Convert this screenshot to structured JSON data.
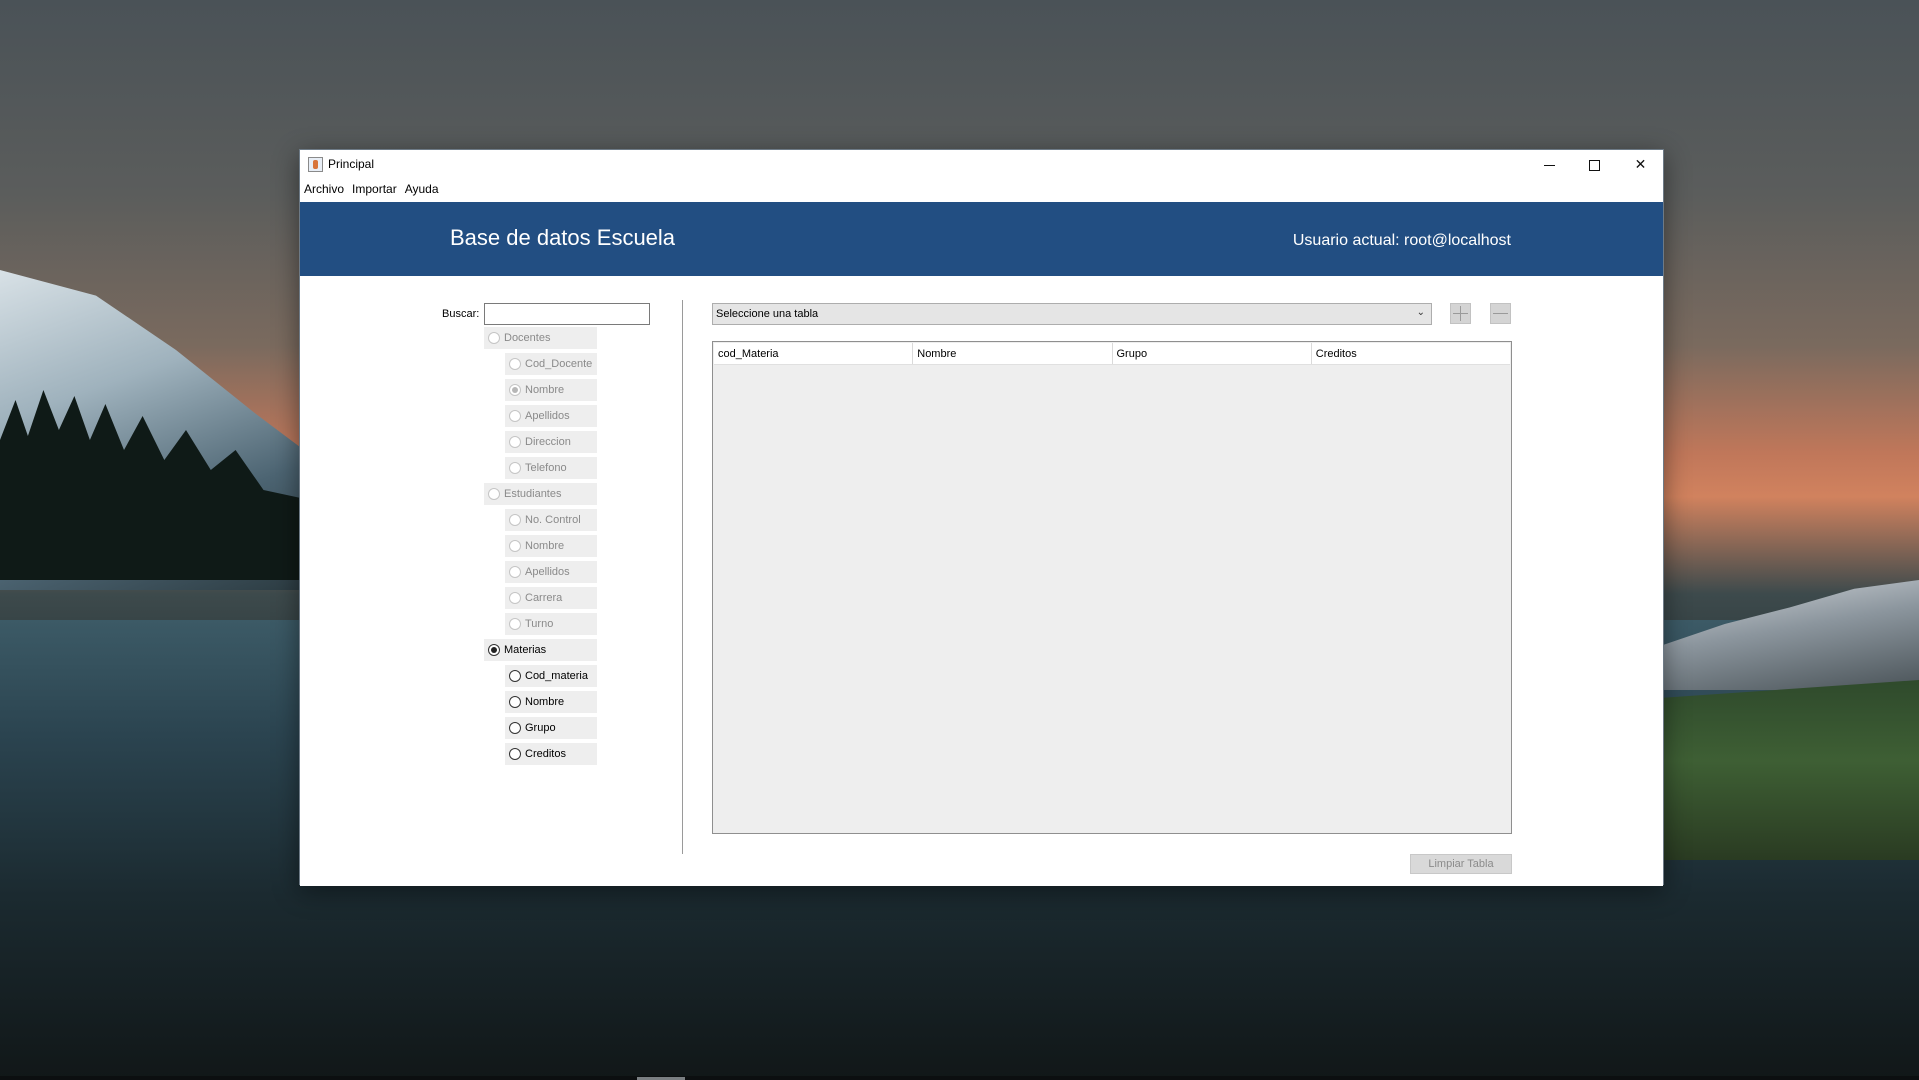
{
  "window": {
    "title": "Principal",
    "controls": {
      "minimize": "minimize",
      "maximize": "maximize",
      "close": "✕"
    }
  },
  "menubar": {
    "items": [
      "Archivo",
      "Importar",
      "Ayuda"
    ]
  },
  "header": {
    "title": "Base de datos Escuela",
    "user": "Usuario actual: root@localhost",
    "background": "#224e82"
  },
  "search": {
    "label": "Buscar:",
    "value": "",
    "placeholder": ""
  },
  "filters": {
    "groups": [
      {
        "label": "Docentes",
        "selected": false,
        "enabled": false,
        "fields": [
          {
            "label": "Cod_Docente",
            "selected": false
          },
          {
            "label": "Nombre",
            "selected": true
          },
          {
            "label": "Apellidos",
            "selected": false
          },
          {
            "label": "Direccion",
            "selected": false
          },
          {
            "label": "Telefono",
            "selected": false
          }
        ]
      },
      {
        "label": "Estudiantes",
        "selected": false,
        "enabled": false,
        "fields": [
          {
            "label": "No. Control",
            "selected": false
          },
          {
            "label": "Nombre",
            "selected": false
          },
          {
            "label": "Apellidos",
            "selected": false
          },
          {
            "label": "Carrera",
            "selected": false
          },
          {
            "label": "Turno",
            "selected": false
          }
        ]
      },
      {
        "label": "Materias",
        "selected": true,
        "enabled": true,
        "fields": [
          {
            "label": "Cod_materia",
            "selected": false
          },
          {
            "label": "Nombre",
            "selected": false
          },
          {
            "label": "Grupo",
            "selected": false
          },
          {
            "label": "Creditos",
            "selected": false
          }
        ]
      }
    ]
  },
  "table_select": {
    "value": "Seleccione una tabla"
  },
  "table": {
    "columns": [
      "cod_Materia",
      "Nombre",
      "Grupo",
      "Creditos"
    ],
    "rows": []
  },
  "actions": {
    "clear_label": "Limpiar Tabla"
  },
  "icons": {
    "add": "plus-icon",
    "remove": "minus-icon",
    "dropdown": "chevron-down-icon"
  }
}
